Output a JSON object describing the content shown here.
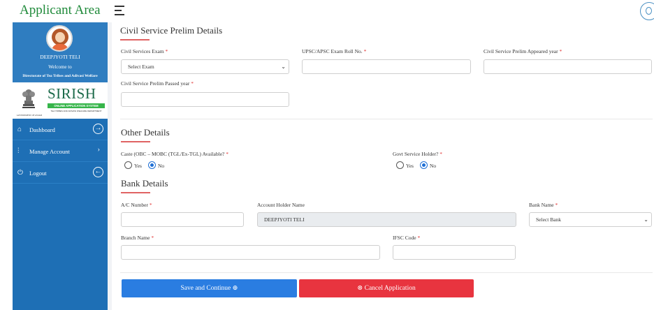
{
  "header": {
    "app_title": "Applicant Area"
  },
  "sidebar": {
    "user_name": "DEEPJYOTI TELI",
    "welcome": "Welcome to",
    "department": "Directorate of Tea Tribes and Adivasi Welfare",
    "logo": {
      "title": "SIRISH",
      "subtitle": "ONLINE APPLICATION SYSTEM",
      "dept_line": "TEA TRIBES AND ADIVASI WELFARE DEPARTMENT",
      "emblem_caption": "GOVERNMENT OF ASSAM"
    },
    "nav": [
      {
        "label": "Dashboard",
        "icon": "home-icon"
      },
      {
        "label": "Manage Account",
        "icon": "sliders-icon"
      },
      {
        "label": "Logout",
        "icon": "power-icon"
      }
    ]
  },
  "civil_service": {
    "title": "Civil Service Prelim Details",
    "exam_label": "Civil Services Exam",
    "exam_value": "Select Exam",
    "roll_label": "UPSC/APSC Exam Roll No.",
    "roll_value": "",
    "appeared_label": "Civil Service Prelim Appeared year",
    "appeared_value": "",
    "passed_label": "Civil Service Prelim Passed year",
    "passed_value": ""
  },
  "other": {
    "title": "Other Details",
    "caste_label": "Caste (OBC – MOBC (TGL/Ex-TGL) Available?",
    "caste_options": [
      "Yes",
      "No"
    ],
    "caste_selected": "No",
    "govt_label": "Govt Service Holder?",
    "govt_options": [
      "Yes",
      "No"
    ],
    "govt_selected": "No"
  },
  "bank": {
    "title": "Bank Details",
    "account_label": "A/C Number",
    "account_value": "",
    "holder_label": "Account Holder Name",
    "holder_value": "DEEPJYOTI  TELI",
    "bank_label": "Bank Name",
    "bank_value": "Select Bank",
    "branch_label": "Branch Name",
    "branch_value": "",
    "ifsc_label": "IFSC Code",
    "ifsc_value": ""
  },
  "actions": {
    "save_label": "Save and Continue",
    "cancel_label": "Cancel Application"
  },
  "colors": {
    "sidebar": "#1e6fb5",
    "title_green": "#1f8a3a",
    "save": "#2a7de1",
    "cancel": "#e8343f"
  }
}
